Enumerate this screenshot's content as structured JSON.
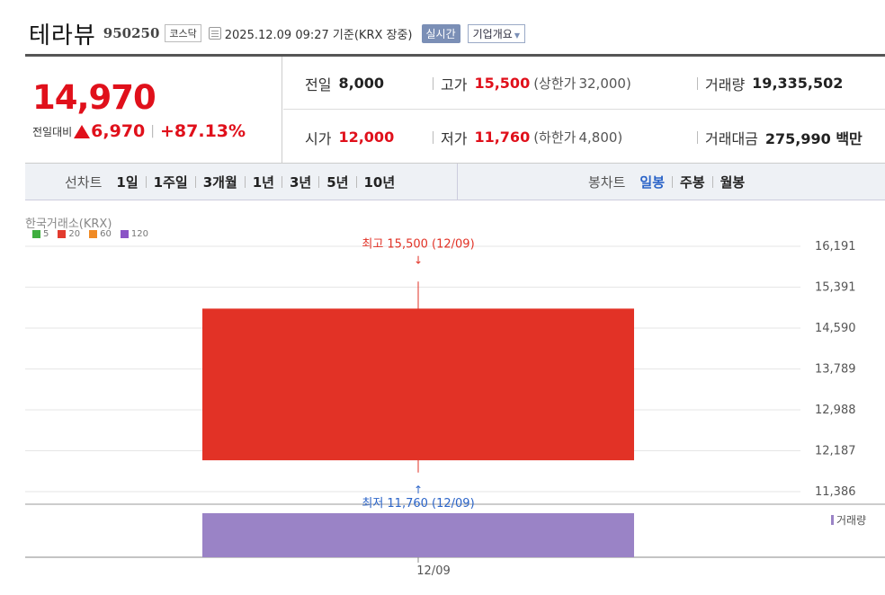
{
  "header": {
    "stock_name": "테라뷰",
    "stock_code": "950250",
    "market": "코스닥",
    "timestamp": "2025.12.09 09:27  기준(KRX 장중)",
    "realtime_label": "실시간",
    "company_info_label": "기업개요"
  },
  "summary": {
    "current_price": "14,970",
    "change_label": "전일대비",
    "change_amount": "6,970",
    "change_percent": "+87.13%",
    "prev_close": {
      "label": "전일",
      "value": "8,000"
    },
    "high": {
      "label": "고가",
      "value": "15,500",
      "limit_label": "(상한가",
      "limit_value": "32,000)"
    },
    "volume": {
      "label": "거래량",
      "value": "19,335,502"
    },
    "open": {
      "label": "시가",
      "value": "12,000"
    },
    "low": {
      "label": "저가",
      "value": "11,760",
      "limit_label": "(하한가",
      "limit_value": "4,800)"
    },
    "trade_value": {
      "label": "거래대금",
      "value": "275,990 백만"
    }
  },
  "period_bar": {
    "line_label": "선차트",
    "line_periods": [
      "1일",
      "1주일",
      "3개월",
      "1년",
      "3년",
      "5년",
      "10년"
    ],
    "candle_label": "봉차트",
    "candle_periods": [
      "일봉",
      "주봉",
      "월봉"
    ],
    "active_candle": "일봉"
  },
  "chart_data": {
    "type": "candlestick",
    "source_label": "한국거래소(KRX)",
    "legend": [
      {
        "name": "5",
        "color": "#3fae3f"
      },
      {
        "name": "20",
        "color": "#e23b2e"
      },
      {
        "name": "60",
        "color": "#f08a24"
      },
      {
        "name": "120",
        "color": "#8b54c6"
      }
    ],
    "y_ticks": [
      "16,191",
      "15,391",
      "14,590",
      "13,789",
      "12,988",
      "12,187",
      "11,386"
    ],
    "y_tick_values": [
      16191,
      15391,
      14590,
      13789,
      12988,
      12187,
      11386
    ],
    "ylim": [
      11386,
      16191
    ],
    "x_ticks": [
      "12/09"
    ],
    "candles": [
      {
        "date": "12/09",
        "open": 12000,
        "high": 15500,
        "low": 11760,
        "close": 14970
      }
    ],
    "high_annotation": "최고 15,500 (12/09)",
    "low_annotation": "최저 11,760 (12/09)",
    "volume_label": "거래량",
    "volume": [
      {
        "date": "12/09",
        "value": 19335502
      }
    ],
    "colors": {
      "up": "#e23226",
      "volume": "#9a83c6",
      "high_text": "#e23226",
      "low_text": "#2b64c8"
    }
  }
}
